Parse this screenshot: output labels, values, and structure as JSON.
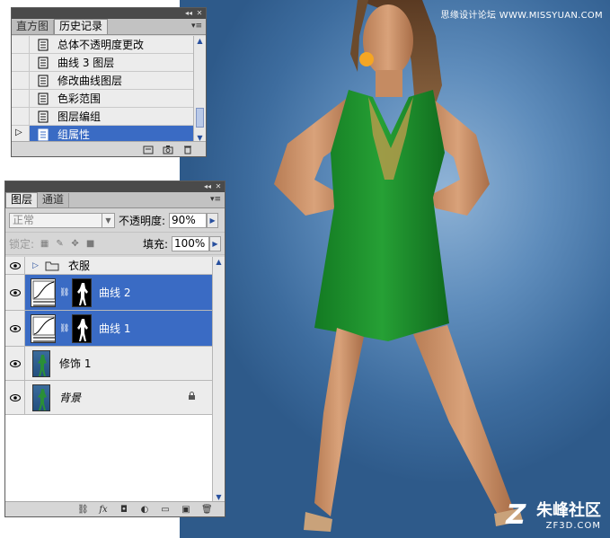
{
  "watermark": {
    "top_text": "思缘设计论坛 WWW.MISSYUAN.COM",
    "logo_cn": "朱峰社区",
    "logo_en": "ZF3D.COM",
    "logo_glyph": "Z"
  },
  "colors": {
    "selection": "#3a6bc4",
    "panel_bg": "#d6d6d6",
    "titlebar": "#4a4a4a",
    "backdrop": "#5f8dbc",
    "dress": "#1f8f2a"
  },
  "history_panel": {
    "titlebar_buttons": [
      "◂◂",
      "✕"
    ],
    "tabs": [
      {
        "label": "直方图",
        "active": false
      },
      {
        "label": "历史记录",
        "active": true
      }
    ],
    "menu_glyph": "▾≡",
    "items": [
      {
        "label": "总体不透明度更改",
        "selected": false,
        "marker": false,
        "icon": "history-state-icon"
      },
      {
        "label": "曲线 3 图层",
        "selected": false,
        "marker": false,
        "icon": "history-state-icon"
      },
      {
        "label": "修改曲线图层",
        "selected": false,
        "marker": false,
        "icon": "history-state-icon"
      },
      {
        "label": "色彩范围",
        "selected": false,
        "marker": false,
        "icon": "history-state-icon"
      },
      {
        "label": "图层编组",
        "selected": false,
        "marker": false,
        "icon": "history-state-icon"
      },
      {
        "label": "组属性",
        "selected": true,
        "marker": true,
        "icon": "history-state-icon"
      }
    ],
    "footer_icons": [
      "new-document-from-state-icon",
      "snapshot-camera-icon",
      "trash-icon"
    ]
  },
  "layers_panel": {
    "titlebar_buttons": [
      "◂◂",
      "✕"
    ],
    "tabs": [
      {
        "label": "图层",
        "active": true
      },
      {
        "label": "通道",
        "active": false
      }
    ],
    "menu_glyph": "▾≡",
    "blend_mode": "正常",
    "opacity_label": "不透明度:",
    "opacity_value": "90%",
    "lock_label": "锁定:",
    "fill_label": "填充:",
    "fill_value": "100%",
    "layers": [
      {
        "name": "衣服",
        "kind": "group",
        "selected": false,
        "visible": true
      },
      {
        "name": "曲线 2",
        "kind": "curves",
        "selected": true,
        "visible": true
      },
      {
        "name": "曲线 1",
        "kind": "curves",
        "selected": true,
        "visible": true
      },
      {
        "name": "修饰 1",
        "kind": "pixel",
        "selected": false,
        "visible": true
      },
      {
        "name": "背景",
        "kind": "background",
        "selected": false,
        "visible": true,
        "locked": true
      }
    ],
    "footer_icons": [
      "link-icon",
      "fx-icon",
      "mask-icon",
      "adjustment-icon",
      "folder-icon",
      "new-layer-icon",
      "trash-icon"
    ],
    "footer_glyphs": [
      "⛓",
      "fx",
      "◘",
      "◐",
      "▭",
      "▣",
      "🗑"
    ]
  }
}
